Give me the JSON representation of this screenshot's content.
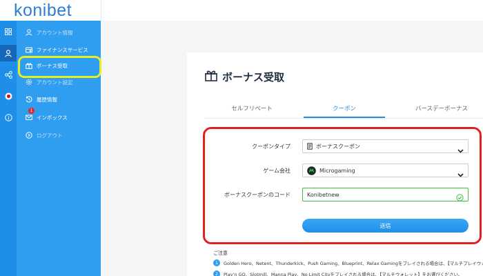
{
  "brand": {
    "logo": "konibet",
    "accent": "#1f8ee8",
    "sidebar_bg": "#2f9df0"
  },
  "rail": {
    "items": [
      {
        "icon": "grid-icon"
      },
      {
        "icon": "user-icon"
      },
      {
        "icon": "share-icon"
      },
      {
        "icon": "flag-japan-icon"
      },
      {
        "icon": "info-icon"
      }
    ]
  },
  "sidebar": {
    "items": [
      {
        "label": "アカウント情報",
        "icon": "user-icon"
      },
      {
        "label": "ファイナンスサービス",
        "icon": "finance-icon"
      },
      {
        "label": "ボーナス受取",
        "icon": "gift-icon"
      },
      {
        "label": "アカウント設定",
        "icon": "gear-icon"
      },
      {
        "label": "履歴情報",
        "icon": "history-icon"
      },
      {
        "label": "インボックス",
        "icon": "mail-icon",
        "badge": "1"
      },
      {
        "label": "ログアウト",
        "icon": "logout-icon"
      }
    ]
  },
  "page": {
    "title": "ボーナス受取",
    "tabs": [
      {
        "label": "セルフリベート"
      },
      {
        "label": "クーポン"
      },
      {
        "label": "バースデーボーナス"
      }
    ],
    "active_tab": "クーポン"
  },
  "form": {
    "coupon_type_label": "クーポンタイプ",
    "coupon_type_value": "ボーナスクーポン",
    "game_company_label": "ゲーム会社",
    "game_company_value": "Microgaming",
    "coupon_code_label": "ボーナスクーポンのコード",
    "coupon_code_value": "Konibetnew",
    "submit_label": "送信"
  },
  "notes": {
    "title": "ご注意",
    "items": [
      {
        "num": "1",
        "text": "Golden Hero、Netent、Thunderkick、Push Gaming、Blueprint、Relax Gamingをプレイされる場合は、【マルチプレイウォレット】"
      },
      {
        "num": "2",
        "text": "Play'n GO、Slotmill、Manna Play、No Limit Cityをプレイされる場合は、【マルチウォレット】をお選びください。"
      }
    ]
  }
}
